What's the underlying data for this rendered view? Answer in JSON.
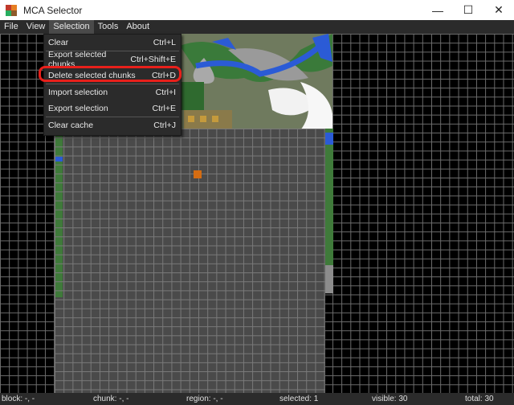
{
  "window": {
    "title": "MCA Selector",
    "minimize": "—",
    "maximize": "☐",
    "close": "✕"
  },
  "menubar": [
    "File",
    "View",
    "Selection",
    "Tools",
    "About"
  ],
  "selection_menu": [
    {
      "label": "Clear",
      "shortcut": "Ctrl+L"
    },
    {
      "label": "Export selected chunks",
      "shortcut": "Ctrl+Shift+E"
    },
    {
      "label": "Delete selected chunks",
      "shortcut": "Ctrl+D"
    },
    {
      "label": "Import selection",
      "shortcut": "Ctrl+I"
    },
    {
      "label": "Export selection",
      "shortcut": "Ctrl+E"
    },
    {
      "label": "Clear cache",
      "shortcut": "Ctrl+J"
    }
  ],
  "status": {
    "block": "block: -, -",
    "chunk": "chunk: -, -",
    "region": "region: -, -",
    "selected": "selected: 1",
    "visible": "visible: 30",
    "total": "total: 30"
  },
  "colors": {
    "highlight": "#e8201b",
    "selected_chunk": "#d46c12"
  }
}
